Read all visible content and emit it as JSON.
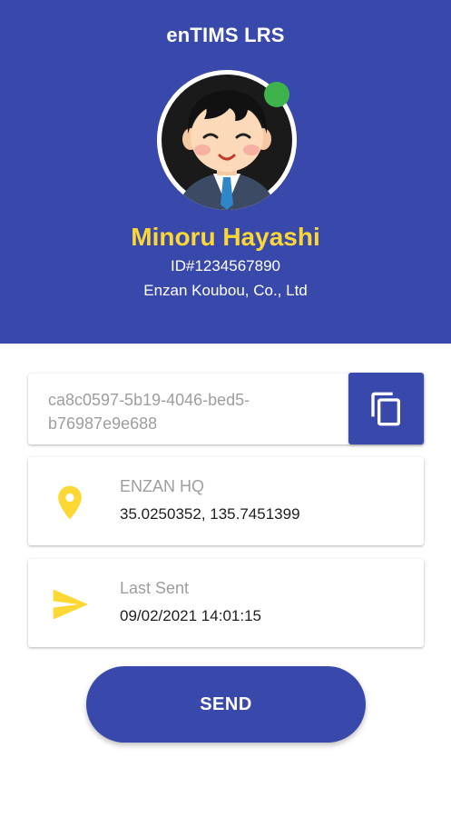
{
  "app": {
    "title": "enTIMS LRS"
  },
  "profile": {
    "name": "Minoru Hayashi",
    "id": "ID#1234567890",
    "company": "Enzan Koubou, Co., Ltd",
    "status": "online",
    "avatar_icon": "person-avatar"
  },
  "token": {
    "value": "ca8c0597-5b19-4046-bed5-b76987e9e688",
    "copy_icon": "copy-icon"
  },
  "location": {
    "icon": "location-pin-icon",
    "label": "ENZAN HQ",
    "coordinates": "35.0250352, 135.7451399"
  },
  "last_sent": {
    "icon": "send-icon",
    "label": "Last Sent",
    "timestamp": "09/02/2021 14:01:15"
  },
  "actions": {
    "send_label": "SEND"
  },
  "colors": {
    "primary": "#3949ab",
    "accent": "#fdd835",
    "status_online": "#3fb34b"
  }
}
